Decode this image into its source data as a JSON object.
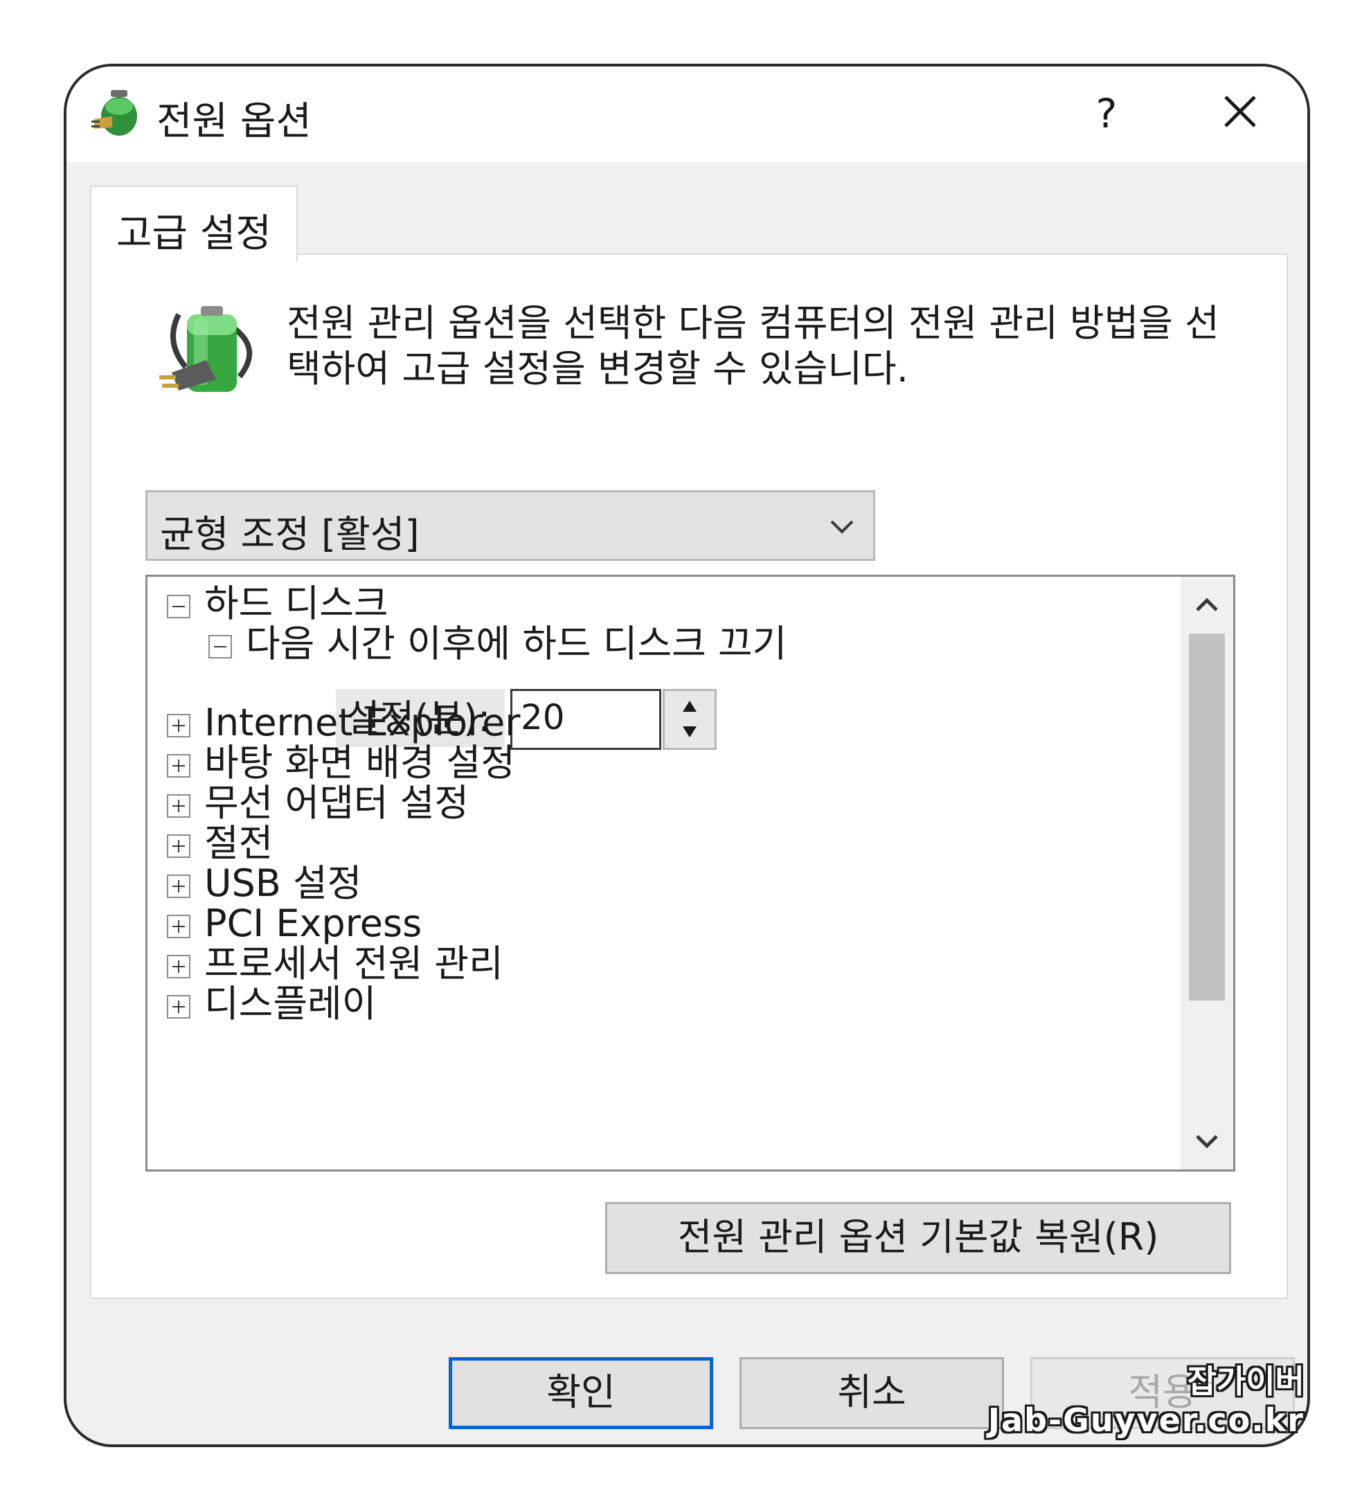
{
  "window": {
    "title": "전원 옵션",
    "help_label": "?",
    "icon": "power-options-icon",
    "close_icon": "close-icon"
  },
  "tabs": [
    {
      "label": "고급 설정",
      "active": true
    }
  ],
  "description": {
    "text": "전원 관리 옵션을 선택한 다음 컴퓨터의 전원 관리 방법을 선택하여 고급 설정을 변경할 수 있습니다.",
    "icon": "battery-plug-icon"
  },
  "plan_select": {
    "value": "균형 조정 [활성]"
  },
  "tree": {
    "items": [
      {
        "label": "하드 디스크",
        "expanded": true
      },
      {
        "label": "다음 시간 이후에 하드 디스크 끄기",
        "expanded": true
      },
      {
        "label": "Internet Explorer",
        "expanded": false
      },
      {
        "label": "바탕 화면 배경 설정",
        "expanded": false
      },
      {
        "label": "무선 어댑터 설정",
        "expanded": false
      },
      {
        "label": "절전",
        "expanded": false
      },
      {
        "label": "USB 설정",
        "expanded": false
      },
      {
        "label": "PCI Express",
        "expanded": false
      },
      {
        "label": "프로세서 전원 관리",
        "expanded": false
      },
      {
        "label": "디스플레이",
        "expanded": false
      }
    ],
    "setting": {
      "label": "설정(분):",
      "value": "20"
    }
  },
  "buttons": {
    "restore": "전원 관리 옵션 기본값 복원(R)",
    "ok": "확인",
    "cancel": "취소",
    "apply": "적용"
  },
  "watermark": {
    "line1": "잡가이버",
    "line2": "Jab-Guyver.co.kr"
  },
  "colors": {
    "accent": "#0a64d0",
    "dialog_bg": "#f0f0f0",
    "battery_green": "#3cb043"
  }
}
